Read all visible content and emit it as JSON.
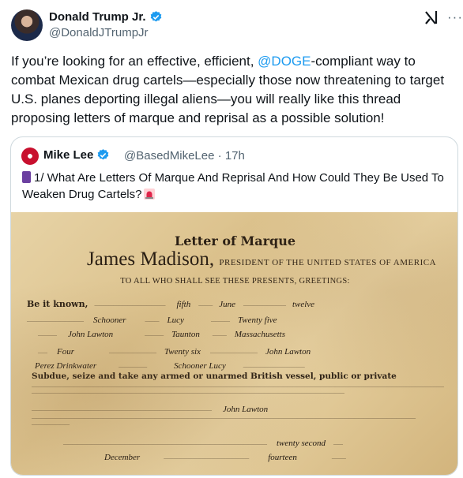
{
  "author": {
    "name": "Donald Trump Jr.",
    "handle": "@DonaldJTrumpJr",
    "verified": true
  },
  "tweet": {
    "text_before_mention": "If you’re looking for an effective, efficient, ",
    "mention": "@DOGE",
    "text_after_mention": "-compliant way to combat Mexican drug cartels—especially those now threatening to target U.S. planes deporting illegal aliens—you will really like this thread proposing letters of marque and reprisal as a possible solution!"
  },
  "quote": {
    "name": "Mike Lee",
    "handle": "@BasedMikeLee",
    "separator": "·",
    "time": "17h",
    "text": "1/ What Are Letters Of Marque And Reprisal And How Could They Be Used To Weaken Drug Cartels?"
  },
  "document": {
    "title": "Letter of Marque",
    "heading_name": "James Madison,",
    "heading_rest": "PRESIDENT OF THE UNITED STATES OF AMERICA",
    "salutation": "TO ALL WHO SHALL SEE THESE PRESENTS, GREETINGS:",
    "be_it_known": "Be it known,",
    "fifth": "fifth",
    "june": "June",
    "twelve": "twelve",
    "schooner": "Schooner",
    "lucy": "Lucy",
    "twenty_five": "Twenty five",
    "john_lawton": "John Lawton",
    "taunton": "Taunton",
    "massachusetts": "Massachusetts",
    "four": "Four",
    "twenty_six": "Twenty six",
    "john_lawton_2": "John Lawton",
    "perez": "Perez Drinkwater",
    "schooner_lucy": "Schooner Lucy",
    "subdue": "Subdue, seize and take any armed or unarmed British vessel, public or private",
    "john_lawton_3": "John Lawton",
    "twenty_second": "twenty second",
    "december": "December",
    "fourteen": "fourteen"
  },
  "colors": {
    "verified": "#1d9bf0",
    "mention": "#1d9bf0",
    "muted": "#536471"
  },
  "icons": {
    "grok": "grok-icon",
    "more": "more-icon"
  }
}
